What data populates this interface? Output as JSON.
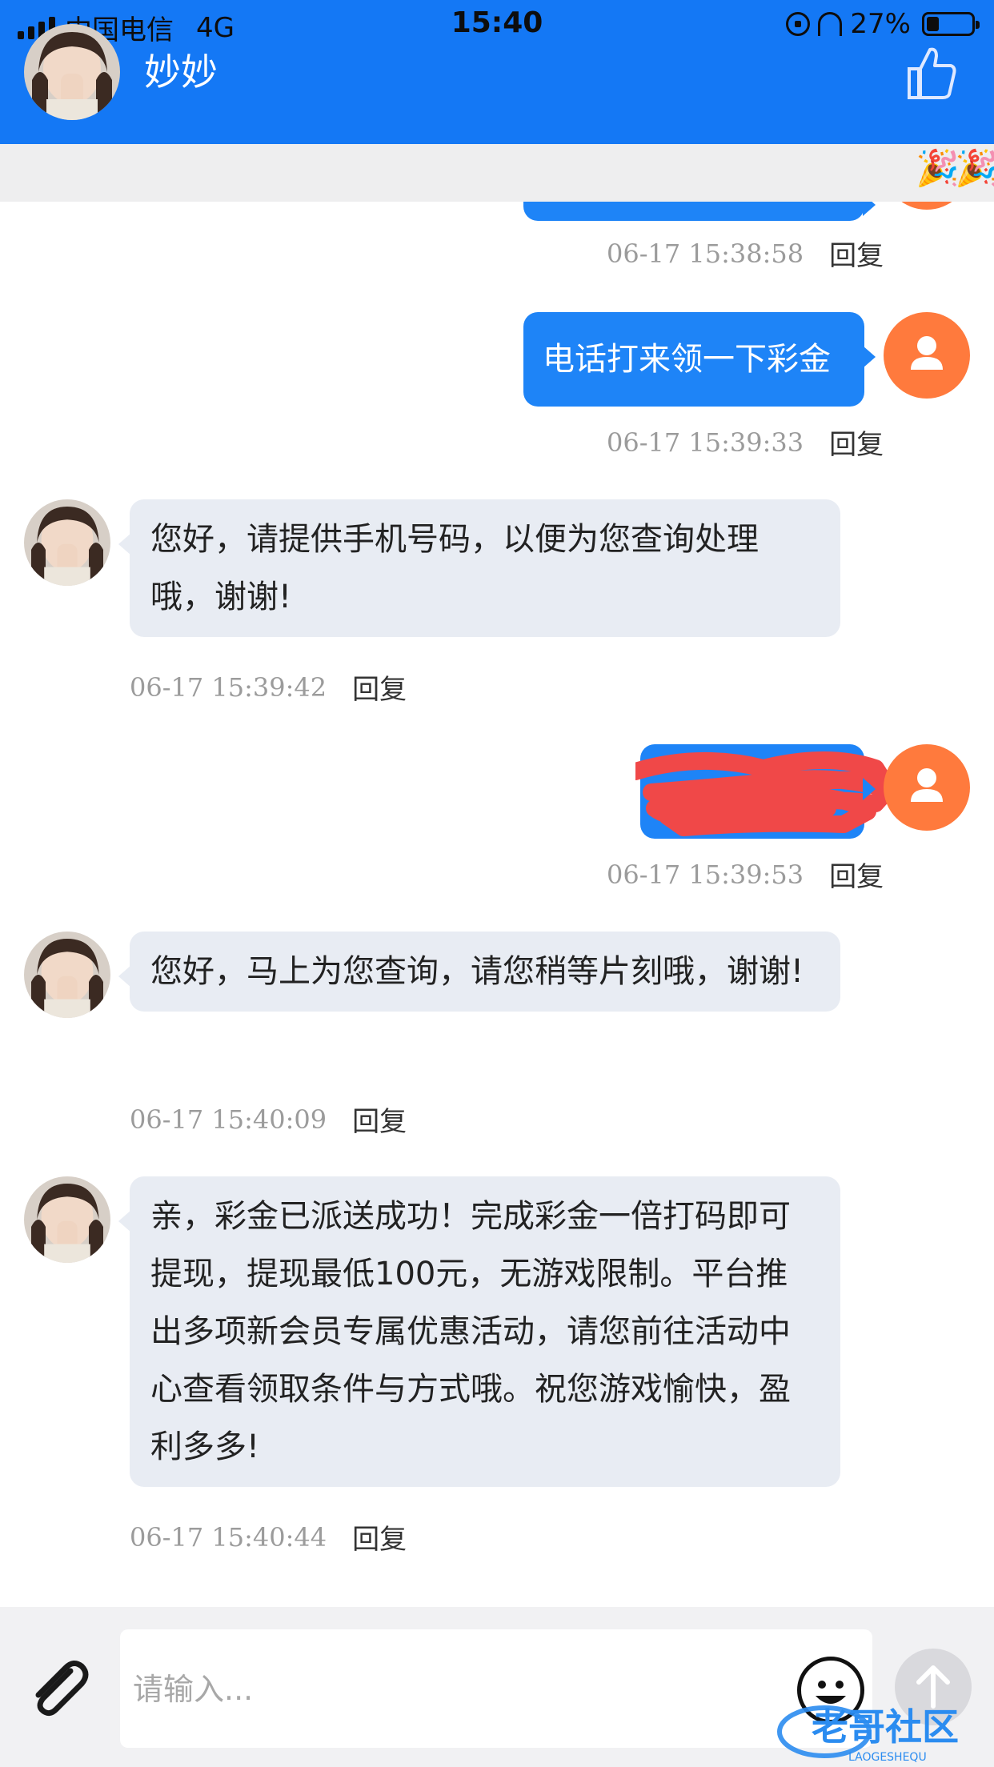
{
  "status_bar": {
    "carrier": "中国电信",
    "network": "4G",
    "time": "15:40",
    "battery": "27%",
    "battery_level": 0.27
  },
  "header": {
    "contact_name": "妙妙",
    "like_icon": "thumbs-up-icon",
    "background_color": "#1478f5"
  },
  "notice": {
    "icon": "party-popper-icon"
  },
  "messages": [
    {
      "direction": "outgoing",
      "text": "",
      "timestamp": "06-17 15:38:58",
      "reply_label": "回复"
    },
    {
      "direction": "outgoing",
      "text": "电话打来领一下彩金",
      "timestamp": "06-17 15:39:33",
      "reply_label": "回复"
    },
    {
      "direction": "incoming",
      "text": "您好，请提供手机号码，以便为您查询处理哦，谢谢!",
      "timestamp": "06-17 15:39:42",
      "reply_label": "回复"
    },
    {
      "direction": "outgoing",
      "text": "",
      "redacted": true,
      "timestamp": "06-17 15:39:53",
      "reply_label": "回复"
    },
    {
      "direction": "incoming",
      "text": "您好，马上为您查询，请您稍等片刻哦，谢谢!",
      "timestamp": "06-17 15:40:09",
      "reply_label": "回复"
    },
    {
      "direction": "incoming",
      "text": "亲，彩金已派送成功！完成彩金一倍打码即可提现，提现最低100元，无游戏限制。平台推出多项新会员专属优惠活动，请您前往活动中心查看领取条件与方式哦。祝您游戏愉快，盈利多多!",
      "timestamp": "06-17 15:40:44",
      "reply_label": "回复"
    }
  ],
  "composer": {
    "placeholder": "请输入...",
    "attach_icon": "paperclip-icon",
    "emoji_icon": "smiley-icon",
    "send_icon": "arrow-up-icon"
  },
  "watermark": {
    "text": "老哥社区",
    "subtext": "LAOGESHEQU"
  },
  "colors": {
    "outgoing_bubble": "#1e84f7",
    "incoming_bubble": "#e8ecf3",
    "user_avatar": "#ff7a3d",
    "redaction": "#f04848"
  }
}
